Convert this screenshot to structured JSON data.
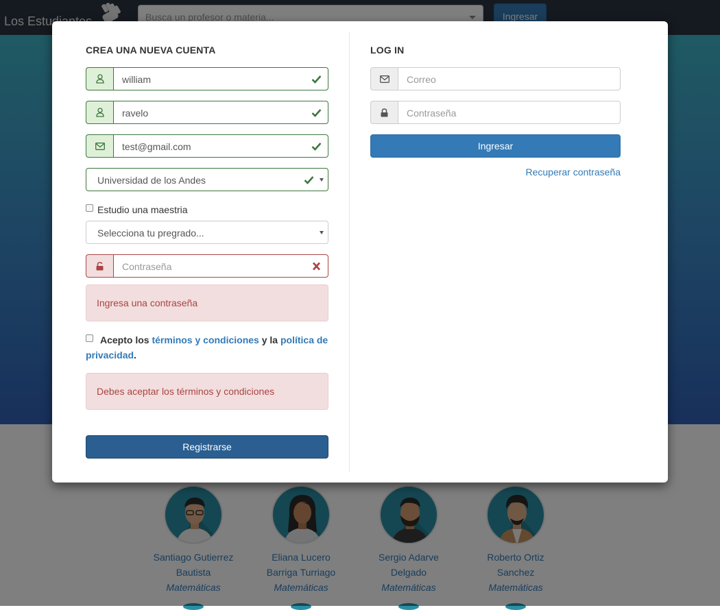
{
  "navbar": {
    "brand": "Los Estudiantes",
    "search_placeholder": "Busca un profesor o materia...",
    "login_button": "Ingresar"
  },
  "profiles": [
    {
      "name_line1": "Santiago Gutierrez",
      "name_line2": "Bautista",
      "field": "Matemáticas"
    },
    {
      "name_line1": "Eliana Lucero",
      "name_line2": "Barriga Turriago",
      "field": "Matemáticas"
    },
    {
      "name_line1": "Sergio Adarve",
      "name_line2": "Delgado",
      "field": "Matemáticas"
    },
    {
      "name_line1": "Roberto Ortiz",
      "name_line2": "Sanchez",
      "field": "Matemáticas"
    }
  ],
  "register": {
    "title": "CREA UNA NUEVA CUENTA",
    "first_name": "william",
    "last_name": "ravelo",
    "email": "test@gmail.com",
    "university": "Universidad de los Andes",
    "masters_label": "Estudio una maestria",
    "program_placeholder": "Selecciona tu pregrado...",
    "password_placeholder": "Contraseña",
    "password_error": "Ingresa una contraseña",
    "terms": {
      "prefix": "Acepto los",
      "terms_link": "términos y condiciones",
      "middle": "y la",
      "privacy_link": "política de privacidad",
      "suffix": "."
    },
    "terms_error": "Debes aceptar los términos y condiciones",
    "submit": "Registrarse"
  },
  "login": {
    "title": "LOG IN",
    "email_placeholder": "Correo",
    "password_placeholder": "Contraseña",
    "submit": "Ingresar",
    "recover": "Recuperar contraseña"
  },
  "colors": {
    "success": "#3c763d",
    "error": "#a94442",
    "primary": "#337ab7",
    "register_button": "#2b5f91"
  },
  "icons": {
    "user": "user-icon",
    "envelope": "envelope-icon",
    "lock": "lock-icon",
    "unlock": "unlock-icon",
    "check": "check-icon",
    "error": "x-icon"
  }
}
